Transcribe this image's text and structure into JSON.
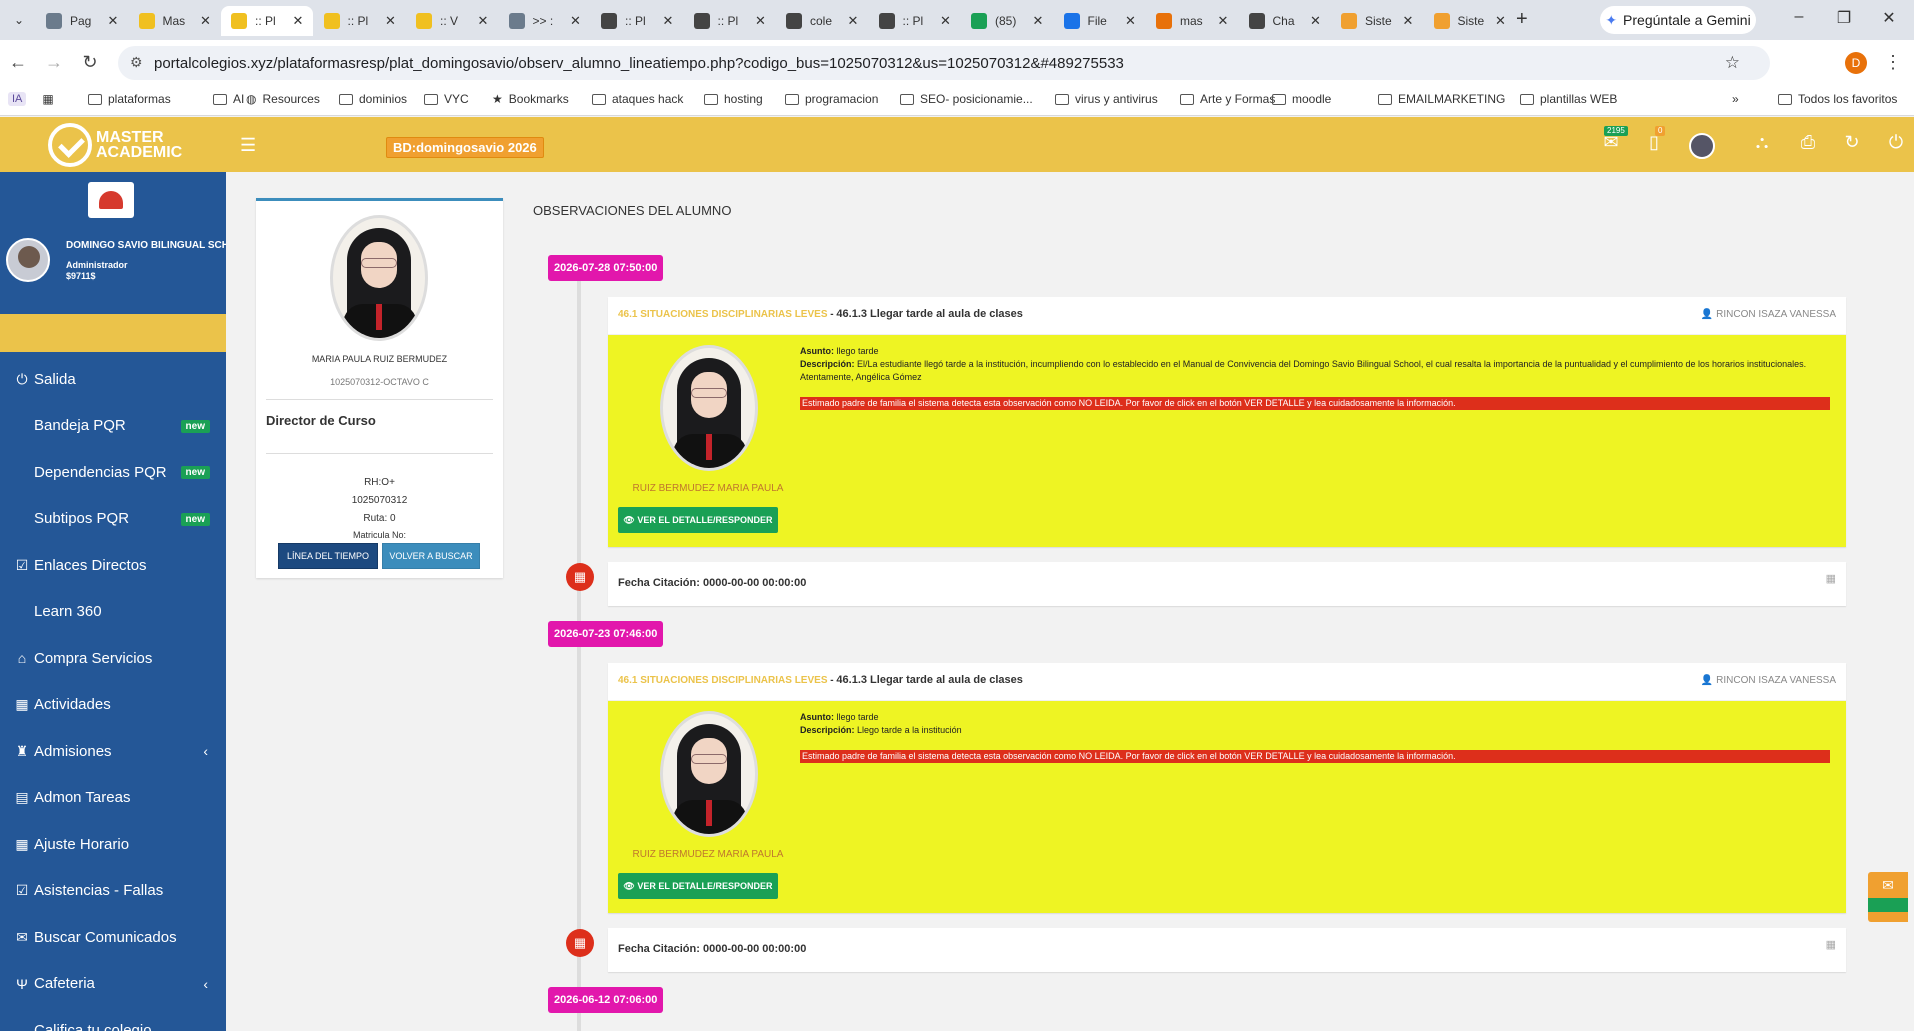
{
  "browser": {
    "tabs": [
      {
        "label": "Pag",
        "color": "#6b7b8c"
      },
      {
        "label": "Mas",
        "color": "#f0c020"
      },
      {
        "label": ":: Pl",
        "color": "#f0c020",
        "active": true
      },
      {
        "label": ":: Pl",
        "color": "#f0c020"
      },
      {
        "label": ":: V",
        "color": "#f0c020"
      },
      {
        "label": ">> :",
        "color": "#6b7b8c"
      },
      {
        "label": ":: Pl",
        "color": "#444444"
      },
      {
        "label": ":: Pl",
        "color": "#444444"
      },
      {
        "label": "cole",
        "color": "#444444"
      },
      {
        "label": ":: Pl",
        "color": "#444444"
      },
      {
        "label": "(85)",
        "color": "#1aa055"
      },
      {
        "label": "File",
        "color": "#1a73e8"
      },
      {
        "label": "mas",
        "color": "#e8710a"
      },
      {
        "label": "Cha",
        "color": "#444444"
      },
      {
        "label": "Siste",
        "color": "#f0a030"
      },
      {
        "label": "Siste",
        "color": "#f0a030"
      }
    ],
    "gemini_label": "Pregúntale a Gemini",
    "url": "portalcolegios.xyz/plataformasresp/plat_domingosavio/observ_alumno_lineatiempo.php?codigo_bus=1025070312&us=1025070312&#489275533",
    "profile_initial": "D",
    "bookmarks": [
      {
        "label": "IA",
        "type": "badge"
      },
      {
        "label": "plataformas",
        "type": "folder"
      },
      {
        "label": "AI",
        "type": "folder"
      },
      {
        "label": "Resources",
        "type": "globe"
      },
      {
        "label": "dominios",
        "type": "folder"
      },
      {
        "label": "VYC",
        "type": "folder"
      },
      {
        "label": "Bookmarks",
        "type": "star"
      },
      {
        "label": "ataques hack",
        "type": "folder"
      },
      {
        "label": "hosting",
        "type": "folder"
      },
      {
        "label": "programacion",
        "type": "folder"
      },
      {
        "label": "SEO- posicionamie...",
        "type": "folder"
      },
      {
        "label": "virus y antivirus",
        "type": "folder"
      },
      {
        "label": "Arte y Formas",
        "type": "folder"
      },
      {
        "label": "moodle",
        "type": "folder"
      },
      {
        "label": "EMAILMARKETING",
        "type": "folder"
      },
      {
        "label": "plantillas WEB",
        "type": "folder"
      }
    ],
    "bookmarks_more": "»",
    "all_bookmarks": "Todos los favoritos"
  },
  "header": {
    "logo_line1": "MASTER",
    "logo_line2": "ACADEMIC",
    "db_badge": "BD:domingosavio 2026",
    "mail_count": "2195",
    "doc_count": "0"
  },
  "sidebar": {
    "school_name": "DOMINGO SAVIO BILINGUAL SCHOOL.",
    "user_role": "Administrador",
    "user_code": "$9711$",
    "items": [
      {
        "label": "Salida",
        "icon": "power-icon"
      },
      {
        "label": "Bandeja PQR",
        "sub": true,
        "new": "new"
      },
      {
        "label": "Dependencias PQR",
        "sub": true,
        "new": "new"
      },
      {
        "label": "Subtipos PQR",
        "sub": true,
        "new": "new"
      },
      {
        "label": "Enlaces Directos",
        "icon": "check-square-icon"
      },
      {
        "label": "Learn 360",
        "sub": true
      },
      {
        "label": "Compra Servicios",
        "icon": "bank-icon"
      },
      {
        "label": "Actividades",
        "icon": "calendar-icon"
      },
      {
        "label": "Admisiones",
        "icon": "admissions-icon",
        "chevron": "‹"
      },
      {
        "label": "Admon Tareas",
        "icon": "list-icon"
      },
      {
        "label": "Ajuste Horario",
        "icon": "calendar-icon"
      },
      {
        "label": "Asistencias - Fallas",
        "icon": "check-square-icon"
      },
      {
        "label": "Buscar Comunicados",
        "icon": "envelope-icon"
      },
      {
        "label": "Cafeteria",
        "icon": "cutlery-icon",
        "chevron": "‹"
      },
      {
        "label": "Califica tu colegio",
        "icon": ""
      }
    ]
  },
  "profile": {
    "name": "MARIA PAULA RUIZ BERMUDEZ",
    "id_group": "1025070312-OCTAVO C",
    "director_label": "Director de Curso",
    "rh": "RH:O+",
    "doc": "1025070312",
    "ruta": "Ruta: 0",
    "matricula": "Matricula No:",
    "btn_timeline": "LÍNEA DEL TIEMPO",
    "btn_back": "VOLVER A BUSCAR"
  },
  "main": {
    "title": "OBSERVACIONES DEL ALUMNO",
    "entries": [
      {
        "date": "2026-07-28 07:50:00",
        "category": "46.1 SITUACIONES DISCIPLINARIAS LEVES",
        "subcategory": "46.1.3 Llegar tarde al aula de clases",
        "teacher": "RINCON ISAZA VANESSA",
        "asunto_label": "Asunto:",
        "asunto": "llego tarde",
        "descripcion_label": "Descripción:",
        "descripcion": "El/La estudiante llegó tarde a la institución, incumpliendo con lo establecido en el Manual de Convivencia del Domingo Savio Bilingual School, el cual resalta la importancia de la puntualidad y el cumplimiento de los horarios institucionales. Atentamente, Angélica Gómez",
        "alert": "Estimado padre de familia el sistema detecta esta observación como NO LEIDA. Por favor de click en el botón VER DETALLE y lea cuidadosamente la información.",
        "student": "RUIZ BERMUDEZ MARIA PAULA",
        "btn_detail": "VER EL DETALLE/RESPONDER",
        "citacion": "Fecha Citación: 0000-00-00 00:00:00"
      },
      {
        "date": "2026-07-23 07:46:00",
        "category": "46.1 SITUACIONES DISCIPLINARIAS LEVES",
        "subcategory": "46.1.3 Llegar tarde al aula de clases",
        "teacher": "RINCON ISAZA VANESSA",
        "asunto_label": "Asunto:",
        "asunto": "llego tarde",
        "descripcion_label": "Descripción:",
        "descripcion": "Llego tarde a la institución",
        "alert": "Estimado padre de familia el sistema detecta esta observación como NO LEIDA. Por favor de click en el botón VER DETALLE y lea cuidadosamente la información.",
        "student": "RUIZ BERMUDEZ MARIA PAULA",
        "btn_detail": "VER EL DETALLE/RESPONDER",
        "citacion": "Fecha Citación: 0000-00-00 00:00:00"
      },
      {
        "date": "2026-06-12 07:06:00"
      }
    ]
  }
}
